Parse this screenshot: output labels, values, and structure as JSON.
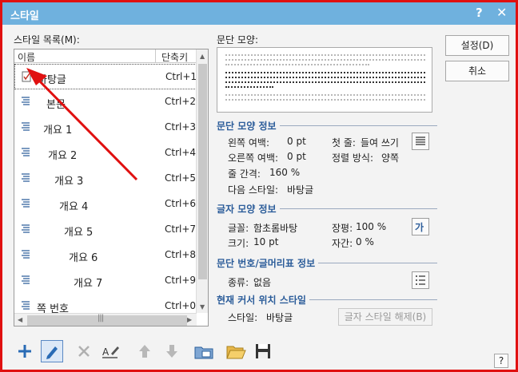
{
  "title": "스타일",
  "title_help": "?",
  "title_close": "✕",
  "list_label": "스타일 목록(M):",
  "list_header": {
    "name": "이름",
    "shortcut": "단축키"
  },
  "styles": [
    {
      "name": "바탕글",
      "shortcut": "Ctrl+1"
    },
    {
      "name": "본문",
      "shortcut": "Ctrl+2"
    },
    {
      "name": "개요 1",
      "shortcut": "Ctrl+3"
    },
    {
      "name": "개요 2",
      "shortcut": "Ctrl+4"
    },
    {
      "name": "개요 3",
      "shortcut": "Ctrl+5"
    },
    {
      "name": "개요 4",
      "shortcut": "Ctrl+6"
    },
    {
      "name": "개요 5",
      "shortcut": "Ctrl+7"
    },
    {
      "name": "개요 6",
      "shortcut": "Ctrl+8"
    },
    {
      "name": "개요 7",
      "shortcut": "Ctrl+9"
    },
    {
      "name": "쪽 번호",
      "shortcut": "Ctrl+0"
    }
  ],
  "preview_label": "문단 모양:",
  "buttons": {
    "settings": "설정(D)",
    "cancel": "취소",
    "release_char_style": "글자 스타일 해제(B)"
  },
  "para_info": {
    "title": "문단 모양 정보",
    "left_margin_label": "왼쪽 여백:",
    "left_margin": "0 pt",
    "first_line_label": "첫 줄:",
    "first_line": "들여 쓰기",
    "right_margin_label": "오른쪽 여백:",
    "right_margin": "0 pt",
    "align_label": "정렬 방식:",
    "align": "양쪽",
    "line_spacing_label": "줄 간격:",
    "line_spacing": "160 %",
    "next_style_label": "다음 스타일:",
    "next_style": "바탕글"
  },
  "char_info": {
    "title": "글자 모양 정보",
    "font_label": "글꼴:",
    "font": "함초롬바탕",
    "width_label": "장평:",
    "width": "100 %",
    "size_label": "크기:",
    "size": "10 pt",
    "spacing_label": "자간:",
    "spacing": "0 %"
  },
  "numbering_info": {
    "title": "문단 번호/글머리표 정보",
    "type_label": "종류:",
    "type": "없음"
  },
  "current_info": {
    "title": "현재 커서 위치 스타일",
    "style_label": "스타일:",
    "style": "바탕글"
  },
  "footer_help": "?",
  "colors": {
    "titlebar": "#6fb1de",
    "section_title": "#2c5d9a",
    "annotation_red": "#e01010"
  }
}
